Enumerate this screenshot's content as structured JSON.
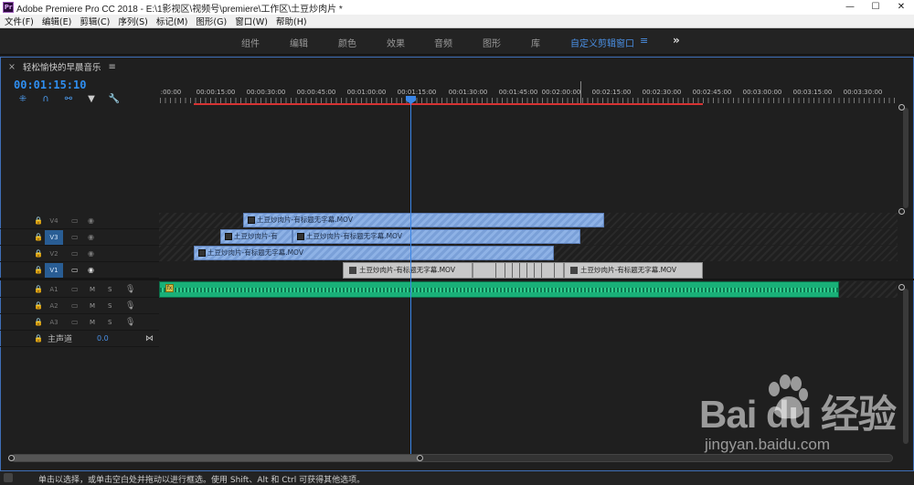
{
  "app": {
    "title": "Adobe Premiere Pro CC 2018 - E:\\1影视区\\视频号\\premiere\\工作区\\土豆炒肉片 *",
    "icon_label": "Pr"
  },
  "window_controls": {
    "minimize": "—",
    "maximize": "☐",
    "close": "✕"
  },
  "menubar": [
    "文件(F)",
    "编辑(E)",
    "剪辑(C)",
    "序列(S)",
    "标记(M)",
    "图形(G)",
    "窗口(W)",
    "帮助(H)"
  ],
  "workspaces": {
    "tabs": [
      "组件",
      "编辑",
      "颜色",
      "效果",
      "音频",
      "图形",
      "库",
      "自定义剪辑窗口"
    ],
    "active": "自定义剪辑窗口",
    "menu_icon": "≡",
    "more_icon": "»"
  },
  "panel": {
    "title": "轻松愉快的早晨音乐",
    "close_icon": "×",
    "menu_icon": "≡",
    "timecode": "00:01:15:10"
  },
  "ruler": {
    "labels": [
      ":00:00",
      "00:00:15:00",
      "00:00:30:00",
      "00:00:45:00",
      "00:01:00:00",
      "00:01:15:00",
      "00:01:30:00",
      "00:01:45:00",
      "00:02:00:00",
      "00:02:15:00",
      "00:02:30:00",
      "00:02:45:00",
      "00:03:00:00",
      "00:03:15:00",
      "00:03:30:00"
    ]
  },
  "tracks": {
    "video": [
      {
        "name": "V4",
        "target": false
      },
      {
        "name": "V3",
        "target": true
      },
      {
        "name": "V2",
        "target": false
      },
      {
        "name": "V1",
        "target": true,
        "active": true
      }
    ],
    "audio": [
      {
        "name": "A1",
        "mute": "M",
        "solo": "S"
      },
      {
        "name": "A2",
        "mute": "M",
        "solo": "S"
      },
      {
        "name": "A3",
        "mute": "M",
        "solo": "S"
      }
    ],
    "master": {
      "label": "主声道",
      "value": "0.0"
    }
  },
  "clips": {
    "v4": "土豆炒肉片-有标题无字幕.MOV",
    "v3a": "土豆炒肉片-有",
    "v3b": "土豆炒肉片-有标题无字幕.MOV",
    "v2": "土豆炒肉片-有标题无字幕.MOV",
    "v1a": "土豆炒肉片-有标题无字幕.MOV",
    "v1b": "土豆炒肉片-有标题无字幕.MOV",
    "a1_fx": "fx"
  },
  "status": {
    "text": "单击以选择，或单击空白处并拖动以进行框选。使用 Shift、Alt 和 Ctrl 可获得其他选项。"
  },
  "watermark": {
    "main": "Bai du 经验",
    "sub": "jingyan.baidu.com"
  },
  "colors": {
    "accent": "#2f8ef0",
    "video_clip": "#8eb2e6",
    "audio_clip": "#19b078",
    "work_area": "#d73232"
  }
}
